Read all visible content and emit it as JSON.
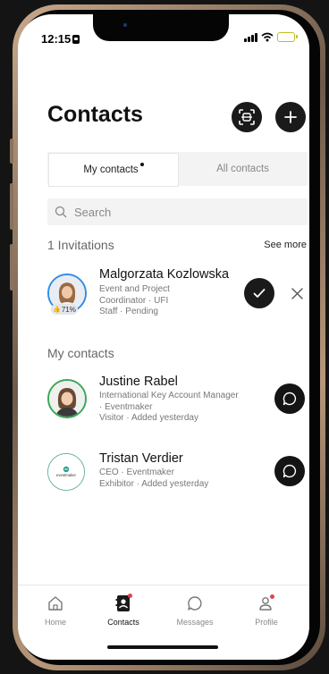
{
  "status_bar": {
    "time": "12:15"
  },
  "header": {
    "title": "Contacts"
  },
  "tabs": [
    {
      "label": "My contacts",
      "active": true,
      "has_dot": true
    },
    {
      "label": "All contacts",
      "active": false
    }
  ],
  "search": {
    "placeholder": "Search"
  },
  "invitations": {
    "title": "1 Invitations",
    "see_more": "See more",
    "items": [
      {
        "name": "Malgorzata Kozlowska",
        "meta": [
          "Event and Project",
          "Coordinator · UFI",
          "Staff · Pending"
        ],
        "score": "71%"
      }
    ]
  },
  "my_contacts": {
    "title": "My contacts",
    "items": [
      {
        "name": "Justine Rabel",
        "meta": [
          "International Key Account Manager",
          "· Eventmaker",
          "Visitor · Added yesterday"
        ]
      },
      {
        "name": "Tristan Verdier",
        "meta": [
          "CEO · Eventmaker",
          "Exhibitor · Added yesterday"
        ],
        "logo_text": "eventmaker"
      }
    ]
  },
  "nav": [
    {
      "label": "Home",
      "icon": "home-icon"
    },
    {
      "label": "Contacts",
      "icon": "contacts-icon",
      "active": true
    },
    {
      "label": "Messages",
      "icon": "messages-icon"
    },
    {
      "label": "Profile",
      "icon": "profile-icon"
    }
  ],
  "colors": {
    "accent": "#1a1a1a",
    "ring_blue": "#2f8de4",
    "ring_green": "#3aa657",
    "notification": "#e0424b"
  }
}
